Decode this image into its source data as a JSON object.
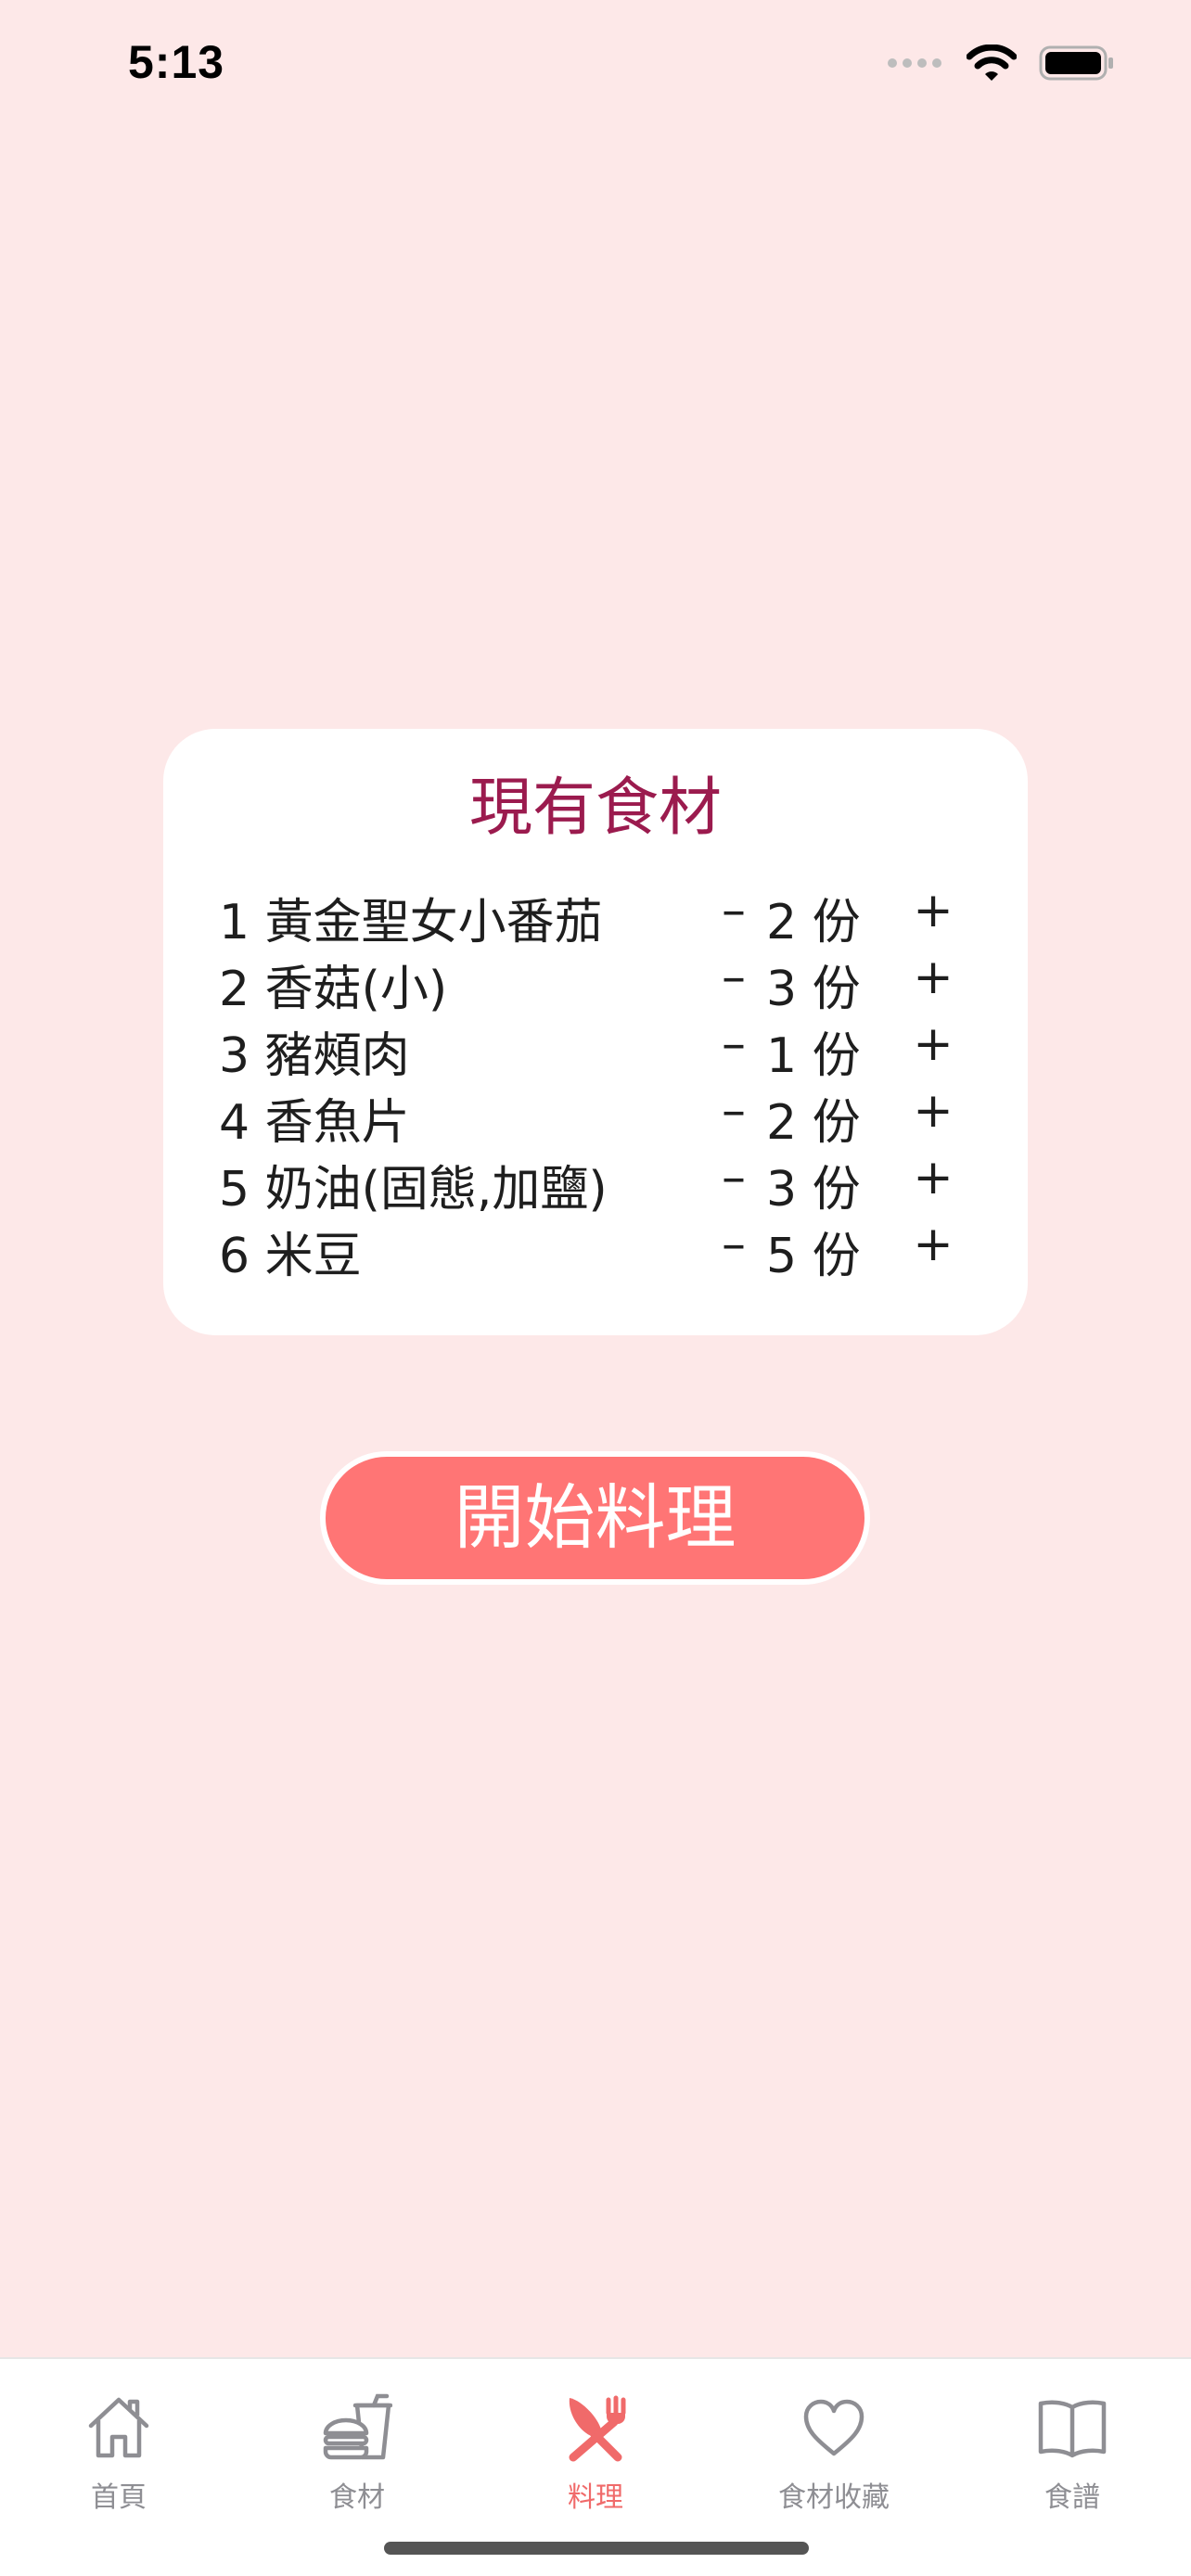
{
  "status_bar": {
    "time": "5:13"
  },
  "card": {
    "title": "現有食材",
    "ingredients": [
      {
        "name": "1 黃金聖女小番茄",
        "minus": "–",
        "quantity": "2 份",
        "plus": "+"
      },
      {
        "name": "2 香菇(小)",
        "minus": "–",
        "quantity": "3 份",
        "plus": "+"
      },
      {
        "name": "3 豬頰肉",
        "minus": "–",
        "quantity": "1 份",
        "plus": "+"
      },
      {
        "name": "4 香魚片",
        "minus": "–",
        "quantity": "2 份",
        "plus": "+"
      },
      {
        "name": "5 奶油(固態,加鹽)",
        "minus": "–",
        "quantity": "3 份",
        "plus": "+"
      },
      {
        "name": "6 米豆",
        "minus": "–",
        "quantity": "5 份",
        "plus": "+"
      }
    ]
  },
  "start_button": {
    "label": "開始料理"
  },
  "tab_bar": {
    "tabs": [
      {
        "label": "首頁",
        "icon": "home-icon"
      },
      {
        "label": "食材",
        "icon": "food-ingredients-icon"
      },
      {
        "label": "料理",
        "icon": "fork-knife-icon",
        "active": true
      },
      {
        "label": "食材收藏",
        "icon": "heart-icon"
      },
      {
        "label": "食譜",
        "icon": "recipe-book-icon"
      }
    ]
  },
  "colors": {
    "background": "#FDE8E8",
    "title": "#9B1B4E",
    "accent": "#FF7575",
    "active_tab": "#F06A6A",
    "inactive_tab": "#8E8E93"
  }
}
